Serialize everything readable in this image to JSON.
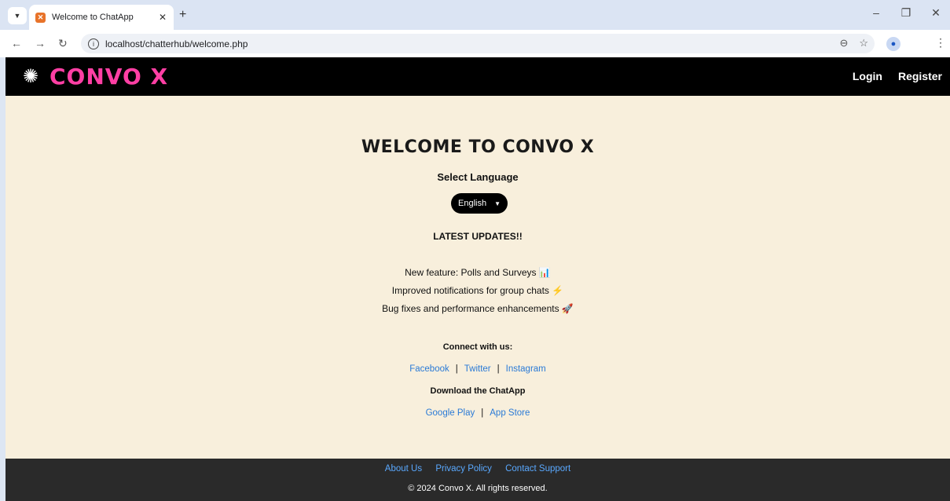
{
  "browser": {
    "tab_title": "Welcome to ChatApp",
    "url": "localhost/chatterhub/welcome.php"
  },
  "header": {
    "logo_text": "CONVO X",
    "login_label": "Login",
    "register_label": "Register"
  },
  "main": {
    "welcome_title": "WELCOME TO CONVO X",
    "language_label": "Select Language",
    "language_selected": "English",
    "updates_title": "LATEST UPDATES!!",
    "updates": [
      {
        "text": "New feature: Polls and Surveys",
        "emoji": "📊"
      },
      {
        "text": "Improved notifications for group chats",
        "emoji": "⚡"
      },
      {
        "text": "Bug fixes and performance enhancements",
        "emoji": "🚀"
      }
    ],
    "connect_title": "Connect with us:",
    "social_links": [
      "Facebook",
      "Twitter",
      "Instagram"
    ],
    "download_title": "Download the ChatApp",
    "store_links": [
      "Google Play",
      "App Store"
    ],
    "separator": "|"
  },
  "footer": {
    "links": [
      "About Us",
      "Privacy Policy",
      "Contact Support"
    ],
    "copyright": "© 2024 Convo X. All rights reserved."
  },
  "colors": {
    "logo": "#ff3fa4",
    "page_bg": "#f8efdc",
    "link": "#2a7ad6",
    "footer_bg": "#2a2a2a"
  }
}
